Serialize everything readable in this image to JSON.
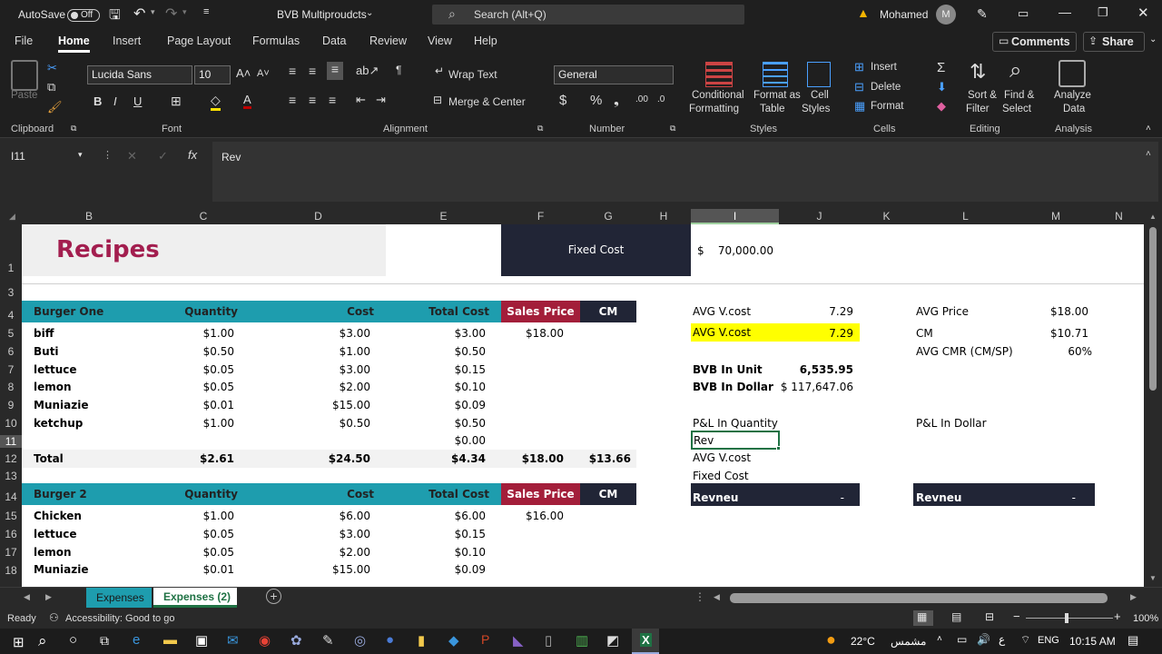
{
  "title_bar": {
    "autosave_label": "AutoSave",
    "autosave_state": "Off",
    "workbook_name": "BVB Multiproudcts",
    "search_placeholder": "Search (Alt+Q)",
    "user_name": "Mohamed",
    "avatar_initial": "M"
  },
  "ribbon_tabs": [
    "File",
    "Home",
    "Insert",
    "Page Layout",
    "Formulas",
    "Data",
    "Review",
    "View",
    "Help"
  ],
  "ribbon_right": {
    "comments": "Comments",
    "share": "Share"
  },
  "ribbon": {
    "clipboard": {
      "paste": "Paste",
      "group": "Clipboard"
    },
    "font": {
      "family": "Lucida Sans",
      "size": "10",
      "group": "Font"
    },
    "alignment": {
      "wrap_text": "Wrap Text",
      "merge_center": "Merge & Center",
      "group": "Alignment"
    },
    "number": {
      "format": "General",
      "group": "Number"
    },
    "styles": {
      "conditional": "Conditional",
      "formatting": "Formatting",
      "format_as": "Format as",
      "table": "Table",
      "cell": "Cell",
      "cell_styles": "Styles",
      "group": "Styles"
    },
    "cells": {
      "insert": "Insert",
      "delete": "Delete",
      "format": "Format",
      "group": "Cells"
    },
    "editing": {
      "sort": "Sort &",
      "filter": "Filter",
      "find": "Find &",
      "select": "Select",
      "group": "Editing"
    },
    "analysis": {
      "analyze": "Analyze",
      "data": "Data",
      "group": "Analysis"
    }
  },
  "formula_bar": {
    "name_box": "I11",
    "formula": "Rev"
  },
  "columns": [
    "B",
    "C",
    "D",
    "E",
    "F",
    "G",
    "H",
    "I",
    "J",
    "K",
    "L",
    "M",
    "N"
  ],
  "rows": [
    "1",
    "3",
    "4",
    "5",
    "6",
    "7",
    "8",
    "9",
    "10",
    "11",
    "12",
    "13",
    "14",
    "15",
    "16",
    "17",
    "18"
  ],
  "sheet": {
    "title": "Recipes",
    "fixed_cost_label": "Fixed Cost",
    "fixed_cost_currency": "$",
    "fixed_cost_value": "70,000.00",
    "burger1": {
      "header": [
        "Burger One",
        "Quantity",
        "Cost",
        "Total Cost",
        "Sales Price",
        "CM"
      ],
      "items": [
        [
          "biff",
          "$1.00",
          "$3.00",
          "$3.00",
          "$18.00"
        ],
        [
          "Buti",
          "$0.50",
          "$1.00",
          "$0.50",
          ""
        ],
        [
          "lettuce",
          "$0.05",
          "$3.00",
          "$0.15",
          ""
        ],
        [
          "lemon",
          "$0.05",
          "$2.00",
          "$0.10",
          ""
        ],
        [
          "Muniazie",
          "$0.01",
          "$15.00",
          "$0.09",
          ""
        ],
        [
          "ketchup",
          "$1.00",
          "$0.50",
          "$0.50",
          ""
        ],
        [
          "",
          "",
          "",
          "$0.00",
          ""
        ]
      ],
      "total": [
        "Total",
        "$2.61",
        "$24.50",
        "$4.34",
        "$18.00",
        "$13.66"
      ]
    },
    "burger2": {
      "header": [
        "Burger 2",
        "Quantity",
        "Cost",
        "Total Cost",
        "Sales Price",
        "CM"
      ],
      "items": [
        [
          "Chicken",
          "$1.00",
          "$6.00",
          "$6.00",
          "$16.00"
        ],
        [
          "lettuce",
          "$0.05",
          "$3.00",
          "$0.15",
          ""
        ],
        [
          "lemon",
          "$0.05",
          "$2.00",
          "$0.10",
          ""
        ],
        [
          "Muniazie",
          "$0.01",
          "$15.00",
          "$0.09",
          ""
        ]
      ]
    },
    "analysis": {
      "avg_vcost_label": "AVG V.cost",
      "avg_vcost_value": "7.29",
      "avg_vcost2_label": "AVG V.cost",
      "avg_vcost2_value": "7.29",
      "bvb_unit_label": "BVB In Unit",
      "bvb_unit_value": "6,535.95",
      "bvb_dollar_label": "BVB In Dollar",
      "bvb_dollar_value": "$ 117,647.06",
      "pl_qty_label": "P&L In Quantity",
      "rev_label": "Rev",
      "avg_vcost3_label": "AVG V.cost",
      "fixed_cost_label": "Fixed Cost",
      "revneu_label": "Revneu",
      "revneu_value": "-",
      "avg_price_label": "AVG Price",
      "avg_price_value": "$18.00",
      "cm_label": "CM",
      "cm_value": "$10.71",
      "cmr_label": "AVG CMR (CM/SP)",
      "cmr_value": "60%",
      "pl_dollar_label": "P&L In Dollar",
      "revneu2_label": "Revneu",
      "revneu2_value": "-"
    }
  },
  "sheet_tabs": [
    "Expenses",
    "Expenses (2)"
  ],
  "status": {
    "ready": "Ready",
    "accessibility": "Accessibility: Good to go",
    "zoom": "100%"
  },
  "taskbar": {
    "temp": "22°C",
    "weather": "مشمس",
    "lang": "ENG",
    "time": "10:15 AM"
  },
  "colors": {
    "teal": "#1e9dae",
    "navy": "#212536",
    "maroon": "#a31e3a",
    "title": "#a31e4f",
    "highlight": "#ffff00",
    "excel_green": "#1f7244"
  }
}
